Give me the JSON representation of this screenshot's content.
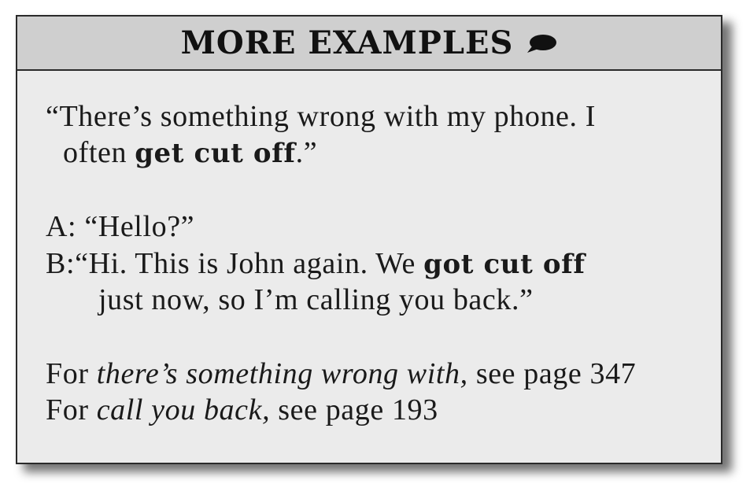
{
  "header": {
    "title": "MORE EXAMPLES",
    "icon": "speech-bubble-icon"
  },
  "example1": {
    "line1": "“There’s something wrong with my phone. I",
    "line2_pre": "often ",
    "line2_bold": "get cut off",
    "line2_post": ".”"
  },
  "dialogue": {
    "a_label": "A:",
    "a_text": "“Hello?”",
    "b_label": "B:",
    "b_pre": "“Hi. This is John again. We ",
    "b_bold": "got cut off",
    "b_line2": "just now, so I’m calling you back.”"
  },
  "references": [
    {
      "pre": "For ",
      "phrase": "there’s something wrong with,",
      "post": " see page 347"
    },
    {
      "pre": "For ",
      "phrase": "call you back,",
      "post": " see page 193"
    }
  ],
  "colors": {
    "header_bg": "#cfcfcf",
    "body_bg": "#ebebeb",
    "border": "#2a2a2a"
  }
}
